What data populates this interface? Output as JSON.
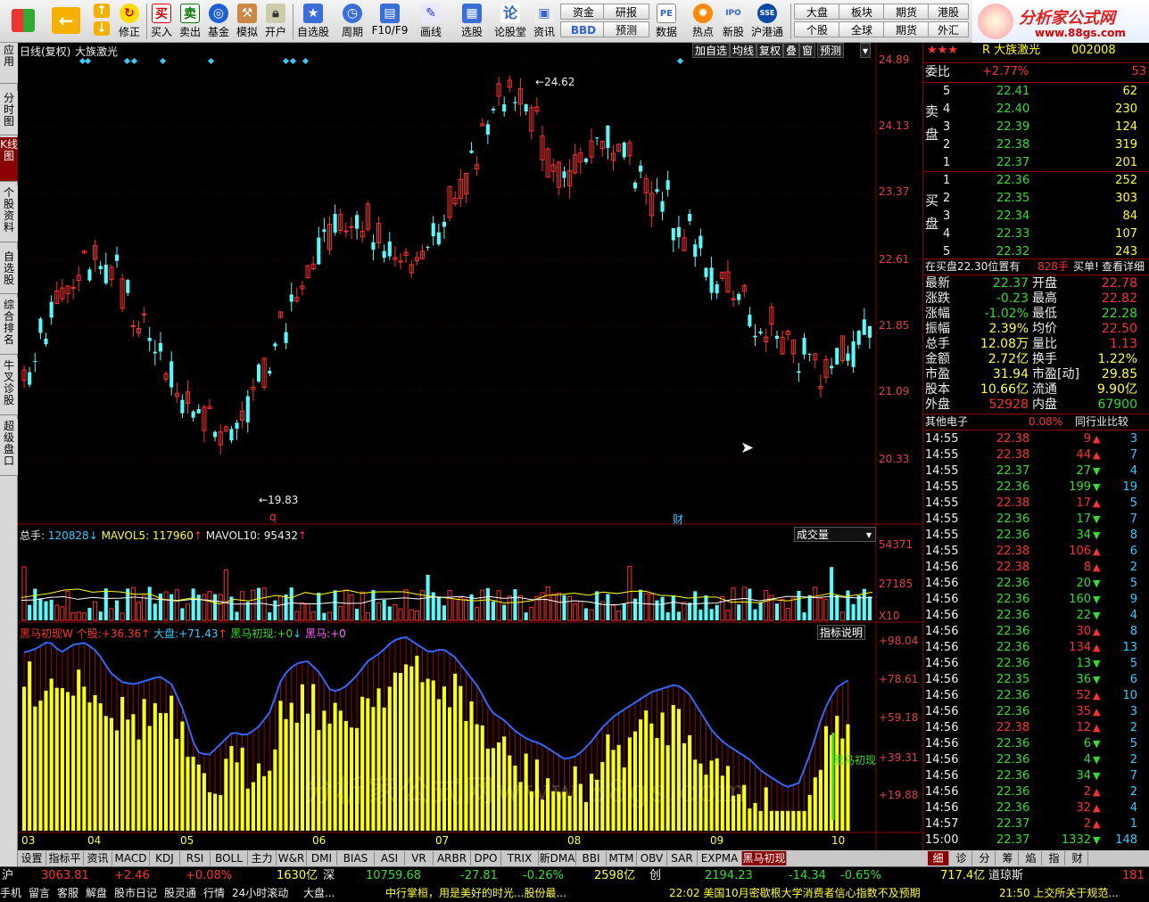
{
  "toolbar": {
    "buttons": [
      "买入",
      "卖出",
      "基金",
      "模拟",
      "开户",
      "自选股",
      "周期",
      "F10/F9",
      "画线",
      "选股",
      "论股堂",
      "资讯",
      "数据",
      "热点",
      "新股",
      "沪港通"
    ],
    "edit": "修正",
    "small": [
      "资金",
      "BBD",
      "研报",
      "预测",
      "大盘",
      "个股",
      "板块",
      "全球",
      "期货",
      "期货",
      "港股",
      "外汇"
    ],
    "pe_label": "PE",
    "brand_title": "分析家公式网",
    "brand_url": "www.88gs.com"
  },
  "left_tabs": [
    "应用",
    "分时图",
    "K线图",
    "个股资料",
    "自选股",
    "综合排名",
    "牛叉诊股",
    "超级盘口"
  ],
  "chart": {
    "title": "日线(复权)",
    "stock_name": "大族激光",
    "tools": [
      "加自选",
      "均线",
      "复权",
      "叠",
      "窗",
      "预测"
    ],
    "price_axis": [
      "24.89",
      "24.13",
      "23.37",
      "22.61",
      "21.85",
      "21.09",
      "20.33"
    ],
    "high_label": "24.62",
    "low_label": "19.83",
    "marker_q": "q",
    "marker_cai": "财",
    "volume_header": {
      "total_label": "总手:",
      "total_value": "120828",
      "mavol5_label": "MAVOL5:",
      "mavol5_value": "117960",
      "mavol10_label": "MAVOL10:",
      "mavol10_value": "95432"
    },
    "volume_select": "成交量",
    "volume_axis": [
      "54371",
      "27185"
    ],
    "volume_unit": "X10",
    "indicator_header": {
      "name": "黑马初现W",
      "stock_label": "个股:",
      "stock_value": "+36.36",
      "market_label": "大盘:",
      "market_value": "+71.43",
      "heima_label": "黑马初现:",
      "heima_value": "+0",
      "hei_label": "黑马:",
      "hei_value": "+0"
    },
    "indicator_help": "指标说明",
    "indicator_axis": [
      "+98.04",
      "+78.61",
      "+59.18",
      "+39.31",
      "+19.88"
    ],
    "signal_label": "黑马初现",
    "months": [
      "03",
      "04",
      "05",
      "06",
      "07",
      "08",
      "09",
      "10"
    ],
    "watermark": "分析家公式网www.88gs.com"
  },
  "bottom_tabs": [
    "设置",
    "指标平台",
    "资讯",
    "MACD",
    "KDJ",
    "RSI",
    "BOLL",
    "主力",
    "W&R",
    "DMI",
    "BIAS",
    "ASI",
    "VR",
    "ARBR",
    "DPO",
    "TRIX",
    "新DMA",
    "BBI",
    "MTM",
    "OBV",
    "SAR",
    "EXPMA",
    "黑马初现W"
  ],
  "right_tabs": [
    "细",
    "诊",
    "分",
    "筹",
    "焰",
    "指",
    "财"
  ],
  "quote": {
    "header_name": "R 大族激光",
    "header_code": "002008",
    "weibi_label": "委比",
    "weibi_value": "+2.77%",
    "weibi_diff": "53",
    "sell_label": "卖盘",
    "buy_label": "买盘",
    "sell": [
      {
        "level": "5",
        "price": "22.41",
        "vol": "62"
      },
      {
        "level": "4",
        "price": "22.40",
        "vol": "230"
      },
      {
        "level": "3",
        "price": "22.39",
        "vol": "124"
      },
      {
        "level": "2",
        "price": "22.38",
        "vol": "319"
      },
      {
        "level": "1",
        "price": "22.37",
        "vol": "201"
      }
    ],
    "buy": [
      {
        "level": "1",
        "price": "22.36",
        "vol": "252"
      },
      {
        "level": "2",
        "price": "22.35",
        "vol": "303"
      },
      {
        "level": "3",
        "price": "22.34",
        "vol": "84"
      },
      {
        "level": "4",
        "price": "22.33",
        "vol": "107"
      },
      {
        "level": "5",
        "price": "22.32",
        "vol": "243"
      }
    ],
    "notice_text": "在买盘22.30位置有",
    "notice_vol": "828手",
    "notice_action": "买单!",
    "notice_link": "查看详细",
    "stats": [
      {
        "l1": "最新",
        "v1": "22.37",
        "l2": "开盘",
        "v2": "22.78"
      },
      {
        "l1": "涨跌",
        "v1": "-0.23",
        "l2": "最高",
        "v2": "22.82"
      },
      {
        "l1": "涨幅",
        "v1": "-1.02%",
        "l2": "最低",
        "v2": "22.28"
      },
      {
        "l1": "振幅",
        "v1": "2.39%",
        "l2": "均价",
        "v2": "22.50"
      },
      {
        "l1": "总手",
        "v1": "12.08万",
        "l2": "量比",
        "v2": "1.13"
      },
      {
        "l1": "金额",
        "v1": "2.72亿",
        "l2": "换手",
        "v2": "1.22%"
      },
      {
        "l1": "市盈",
        "v1": "31.94",
        "l2": "市盈[动]",
        "v2": "29.85"
      },
      {
        "l1": "股本",
        "v1": "10.66亿",
        "l2": "流通",
        "v2": "9.90亿"
      },
      {
        "l1": "外盘",
        "v1": "52928",
        "l2": "内盘",
        "v2": "67900"
      }
    ],
    "sector_name": "其他电子",
    "sector_change": "0.08%",
    "sector_compare": "同行业比较",
    "ticks": [
      {
        "t": "14:55",
        "p": "22.38",
        "v": "9",
        "d": "up",
        "n": "3"
      },
      {
        "t": "14:55",
        "p": "22.38",
        "v": "44",
        "d": "up",
        "n": "7"
      },
      {
        "t": "14:55",
        "p": "22.37",
        "v": "27",
        "d": "down",
        "n": "4"
      },
      {
        "t": "14:55",
        "p": "22.36",
        "v": "199",
        "d": "down",
        "n": "19"
      },
      {
        "t": "14:55",
        "p": "22.38",
        "v": "17",
        "d": "up",
        "n": "5"
      },
      {
        "t": "14:55",
        "p": "22.36",
        "v": "17",
        "d": "down",
        "n": "7"
      },
      {
        "t": "14:55",
        "p": "22.36",
        "v": "34",
        "d": "down",
        "n": "8"
      },
      {
        "t": "14:55",
        "p": "22.38",
        "v": "106",
        "d": "up",
        "n": "6"
      },
      {
        "t": "14:56",
        "p": "22.38",
        "v": "8",
        "d": "up",
        "n": "2"
      },
      {
        "t": "14:56",
        "p": "22.36",
        "v": "20",
        "d": "down",
        "n": "5"
      },
      {
        "t": "14:56",
        "p": "22.36",
        "v": "160",
        "d": "down",
        "n": "9"
      },
      {
        "t": "14:56",
        "p": "22.36",
        "v": "22",
        "d": "down",
        "n": "4"
      },
      {
        "t": "14:56",
        "p": "22.36",
        "v": "30",
        "d": "up",
        "n": "8"
      },
      {
        "t": "14:56",
        "p": "22.36",
        "v": "134",
        "d": "up",
        "n": "13"
      },
      {
        "t": "14:56",
        "p": "22.36",
        "v": "13",
        "d": "down",
        "n": "5"
      },
      {
        "t": "14:56",
        "p": "22.35",
        "v": "36",
        "d": "down",
        "n": "6"
      },
      {
        "t": "14:56",
        "p": "22.36",
        "v": "52",
        "d": "up",
        "n": "10"
      },
      {
        "t": "14:56",
        "p": "22.36",
        "v": "35",
        "d": "up",
        "n": "3"
      },
      {
        "t": "14:56",
        "p": "22.38",
        "v": "12",
        "d": "up",
        "n": "2"
      },
      {
        "t": "14:56",
        "p": "22.36",
        "v": "6",
        "d": "down",
        "n": "5"
      },
      {
        "t": "14:56",
        "p": "22.36",
        "v": "4",
        "d": "down",
        "n": "2"
      },
      {
        "t": "14:56",
        "p": "22.36",
        "v": "34",
        "d": "down",
        "n": "7"
      },
      {
        "t": "14:56",
        "p": "22.36",
        "v": "2",
        "d": "up",
        "n": "2"
      },
      {
        "t": "14:56",
        "p": "22.36",
        "v": "32",
        "d": "up",
        "n": "4"
      },
      {
        "t": "14:57",
        "p": "22.37",
        "v": "2",
        "d": "up",
        "n": "1"
      },
      {
        "t": "15:00",
        "p": "22.37",
        "v": "1332",
        "d": "down",
        "n": "148"
      }
    ]
  },
  "status": {
    "sh_label": "沪",
    "sh_index": "3063.81",
    "sh_change": "+2.46",
    "sh_pct": "+0.08%",
    "sh_amount": "1630亿",
    "sz_label": "深",
    "sz_index": "10759.68",
    "sz_change": "-27.81",
    "sz_pct": "-0.26%",
    "sz_amount": "2598亿",
    "cy_label": "创",
    "cy_index": "2194.23",
    "cy_change": "-14.34",
    "cy_pct": "-0.65%",
    "cy_amount": "717.4亿",
    "dj_label": "道琼斯",
    "dj_value": "181",
    "menu": [
      "手机",
      "留言",
      "客服",
      "解盘",
      "股市日记",
      "股灵通",
      "行情",
      "24小时滚动",
      "大盘..."
    ],
    "news1": "中行掌桓，用是美好的时光...股份最... ",
    "news_time": "22:02 美国10月密歇根大学消费者信心指数不及预期",
    "news_time2": "21:50 上交所关于规范..."
  },
  "colors": {
    "up": "#ff3030",
    "down": "#54fcfc",
    "bg": "#000000",
    "axis": "#8b0000",
    "indicator_bar": "#ffff00",
    "indicator_line": "#3366ff"
  }
}
